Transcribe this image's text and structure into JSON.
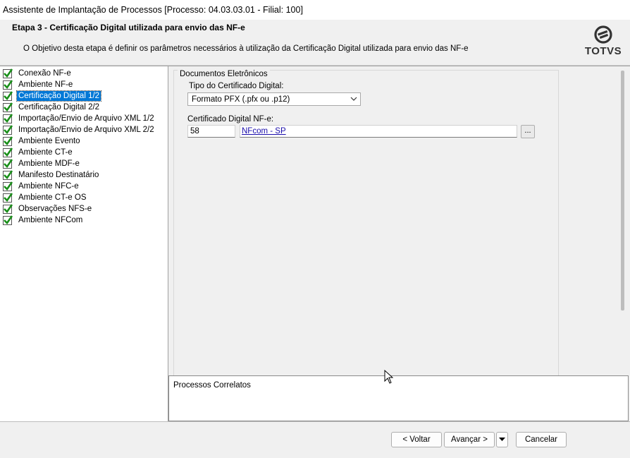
{
  "window": {
    "title": "Assistente de Implantação de Processos [Processo: 04.03.03.01 - Filial: 100]"
  },
  "header": {
    "stage_title": "Etapa 3 - Certificação Digital utilizada para envio das NF-e",
    "stage_description": "O Objetivo desta etapa é definir os parâmetros necessários à utilização da Certificação Digital utilizada para envio das NF-e",
    "logo_text": "TOTVS"
  },
  "tree": {
    "selected_index": 2,
    "items": [
      {
        "label": "Conexão NF-e",
        "checked": true
      },
      {
        "label": "Ambiente NF-e",
        "checked": true
      },
      {
        "label": "Certificação Digital 1/2",
        "checked": true
      },
      {
        "label": "Certificação Digital 2/2",
        "checked": true
      },
      {
        "label": "Importação/Envio de Arquivo XML 1/2",
        "checked": true
      },
      {
        "label": "Importação/Envio de Arquivo XML 2/2",
        "checked": true
      },
      {
        "label": "Ambiente Evento",
        "checked": true
      },
      {
        "label": "Ambiente CT-e",
        "checked": true
      },
      {
        "label": "Ambiente MDF-e",
        "checked": true
      },
      {
        "label": "Manifesto Destinatário",
        "checked": true
      },
      {
        "label": "Ambiente NFC-e",
        "checked": true
      },
      {
        "label": "Ambiente CT-e OS",
        "checked": true
      },
      {
        "label": "Observações NFS-e",
        "checked": true
      },
      {
        "label": "Ambiente NFCom",
        "checked": true
      }
    ]
  },
  "form": {
    "group_label": "Documentos Eletrônicos",
    "cert_type_label": "Tipo do Certificado Digital:",
    "cert_type_value": "Formato PFX (.pfx ou .p12)",
    "cert_label": "Certificado Digital NF-e:",
    "cert_code": "58",
    "cert_link": "NFcom -  SP",
    "browse_label": "..."
  },
  "related": {
    "title": "Processos Correlatos"
  },
  "buttons": {
    "back": "< Voltar",
    "next": "Avançar >",
    "cancel": "Cancelar"
  },
  "colors": {
    "selection": "#0078d7",
    "check": "#1a8f1a",
    "link": "#1a0dab"
  }
}
